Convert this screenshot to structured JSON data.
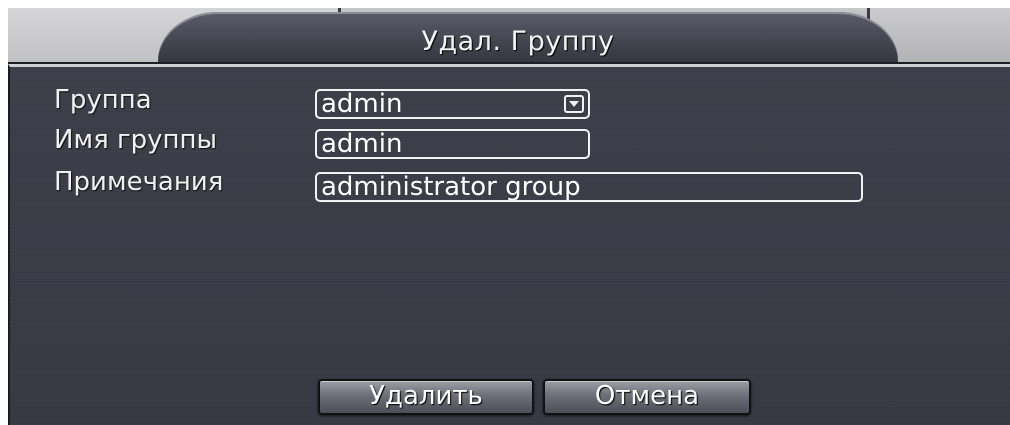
{
  "dialog": {
    "title": "Удал. Группу"
  },
  "form": {
    "group_label": "Группа",
    "group_value": "admin",
    "group_name_label": "Имя группы",
    "group_name_value": "admin",
    "notes_label": "Примечания",
    "notes_value": "administrator group"
  },
  "buttons": {
    "delete_label": "Удалить",
    "cancel_label": "Отмена"
  },
  "icons": {
    "dropdown": "chevron-down-icon"
  },
  "colors": {
    "panel_bg": "#3a3c47",
    "text": "#f1f1f1",
    "field_border": "#f2f2f2"
  }
}
